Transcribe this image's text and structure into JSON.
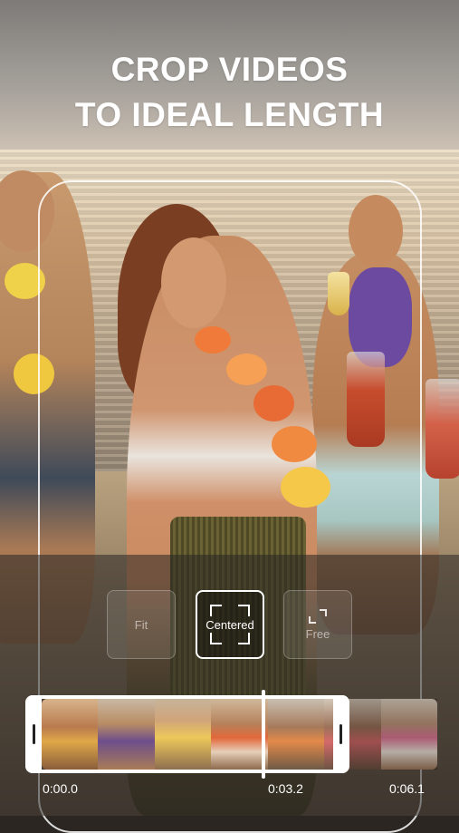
{
  "headline": {
    "line1": "CROP VIDEOS",
    "line2": "TO IDEAL LENGTH"
  },
  "crop_modes": [
    {
      "label": "Fit",
      "selected": false
    },
    {
      "label": "Centered",
      "selected": true
    },
    {
      "label": "Free",
      "selected": false
    }
  ],
  "timeline": {
    "times": [
      "0:00.0",
      "0:03.2",
      "0:06.1"
    ]
  },
  "colors": {
    "headline_text": "#ffffff",
    "selection_border": "#ffffff"
  }
}
